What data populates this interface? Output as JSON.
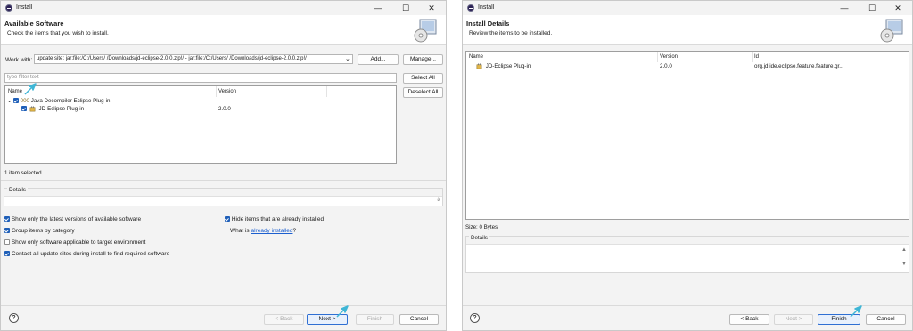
{
  "left": {
    "title": "Install",
    "banner_title": "Available Software",
    "banner_subtitle": "Check the items that you wish to install.",
    "work_with_label": "Work with:",
    "work_with_value": "update site: jar:file:/C:/Users/         /Downloads/jd-eclipse-2.0.0.zip!/ - jar:file:/C:/Users/         /Downloads/jd-eclipse-2.0.0.zip!/",
    "add_label": "Add...",
    "manage_label": "Manage...",
    "filter_placeholder": "type filter text",
    "select_all_label": "Select All",
    "deselect_all_label": "Deselect All",
    "columns": [
      "Name",
      "Version"
    ],
    "rows": [
      {
        "name": "Java Decompiler Eclipse Plug-in",
        "version": ""
      },
      {
        "name": "JD-Eclipse Plug-in",
        "version": "2.0.0"
      }
    ],
    "pkg_prefix": "000",
    "selection_status": "1 item selected",
    "details_label": "Details",
    "options": [
      "Show only the latest versions of available software",
      "Group items by category",
      "Show only software applicable to target environment",
      "Contact all update sites during install to find required software"
    ],
    "hide_installed_label": "Hide items that are already installed",
    "what_is_label": "What is",
    "already_installed_link": "already installed",
    "what_is_suffix": "?",
    "buttons": {
      "back": "< Back",
      "next": "Next >",
      "finish": "Finish",
      "cancel": "Cancel"
    }
  },
  "right": {
    "title": "Install",
    "banner_title": "Install Details",
    "banner_subtitle": "Review the items to be installed.",
    "columns": [
      "Name",
      "Version",
      "Id"
    ],
    "rows": [
      {
        "name": "JD-Eclipse Plug-in",
        "version": "2.0.0",
        "id": "org.jd.ide.eclipse.feature.feature.gr..."
      }
    ],
    "size_label": "Size: 0 Bytes",
    "details_label": "Details",
    "buttons": {
      "back": "< Back",
      "next": "Next >",
      "finish": "Finish",
      "cancel": "Cancel"
    }
  },
  "window_controls": {
    "minimize": "—",
    "maximize": "☐",
    "close": "✕"
  },
  "help_glyph": "?",
  "colors": {
    "accent": "#1f5fb8",
    "highlight_arrow": "#3fb6d6",
    "default_button": "#2f6fd3"
  }
}
